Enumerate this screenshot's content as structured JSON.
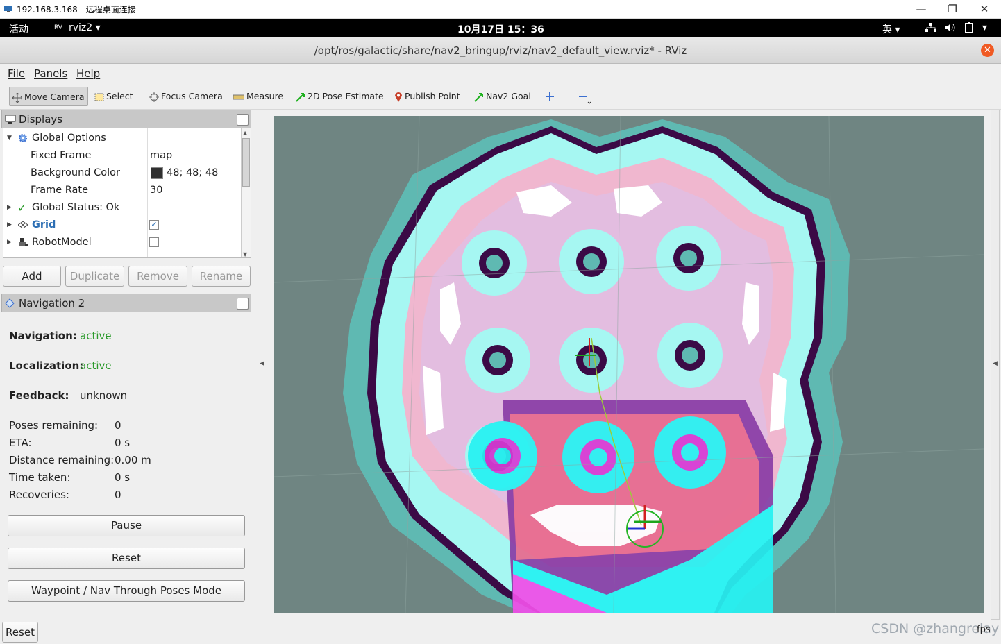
{
  "rdp": {
    "title": "192.168.3.168 - 远程桌面连接",
    "min": "—",
    "restore": "❐",
    "close": "✕"
  },
  "gnome": {
    "activities": "活动",
    "app": "rviz2 ▾",
    "clock": "10月17日  15：36",
    "ime": "英 ▾",
    "status": "▾"
  },
  "window": {
    "title": "/opt/ros/galactic/share/nav2_bringup/rviz/nav2_default_view.rviz* - RViz",
    "close": "✕"
  },
  "menu": {
    "file": "File",
    "panels": "Panels",
    "help": "Help"
  },
  "toolbar": {
    "move_camera": "Move Camera",
    "select": "Select",
    "focus_camera": "Focus Camera",
    "measure": "Measure",
    "pose_estimate": "2D Pose Estimate",
    "publish_point": "Publish Point",
    "nav2_goal": "Nav2 Goal"
  },
  "displays": {
    "title": "Displays",
    "rows": [
      {
        "label": "Global Options",
        "value": ""
      },
      {
        "label": "Fixed Frame",
        "value": "map"
      },
      {
        "label": "Background Color",
        "value": "48; 48; 48"
      },
      {
        "label": "Frame Rate",
        "value": "30"
      },
      {
        "label": "Global Status: Ok",
        "value": ""
      },
      {
        "label": "Grid",
        "value": ""
      },
      {
        "label": "RobotModel",
        "value": ""
      }
    ],
    "buttons": {
      "add": "Add",
      "duplicate": "Duplicate",
      "remove": "Remove",
      "rename": "Rename"
    }
  },
  "navigation": {
    "title": "Navigation 2",
    "navigation_label": "Navigation:",
    "navigation_value": "active",
    "localization_label": "Localization:",
    "localization_value": "active",
    "feedback_label": "Feedback:",
    "feedback_value": "unknown",
    "stats": [
      {
        "label": "Poses remaining:",
        "value": "0"
      },
      {
        "label": "ETA:",
        "value": "0 s"
      },
      {
        "label": "Distance remaining:",
        "value": "0.00 m"
      },
      {
        "label": "Time taken:",
        "value": "0 s"
      },
      {
        "label": "Recoveries:",
        "value": "0"
      }
    ],
    "pause": "Pause",
    "reset": "Reset",
    "waypoint": "Waypoint / Nav Through Poses Mode"
  },
  "bottom": {
    "reset": "Reset",
    "fps": "fps"
  },
  "watermark": "CSDN @zhangrelay",
  "colors": {
    "accent_green": "#2a9a2a",
    "map_bg": "#6f8582",
    "costmap_cyan": "#7ff2ee",
    "costmap_pink": "#e9b8d8"
  }
}
